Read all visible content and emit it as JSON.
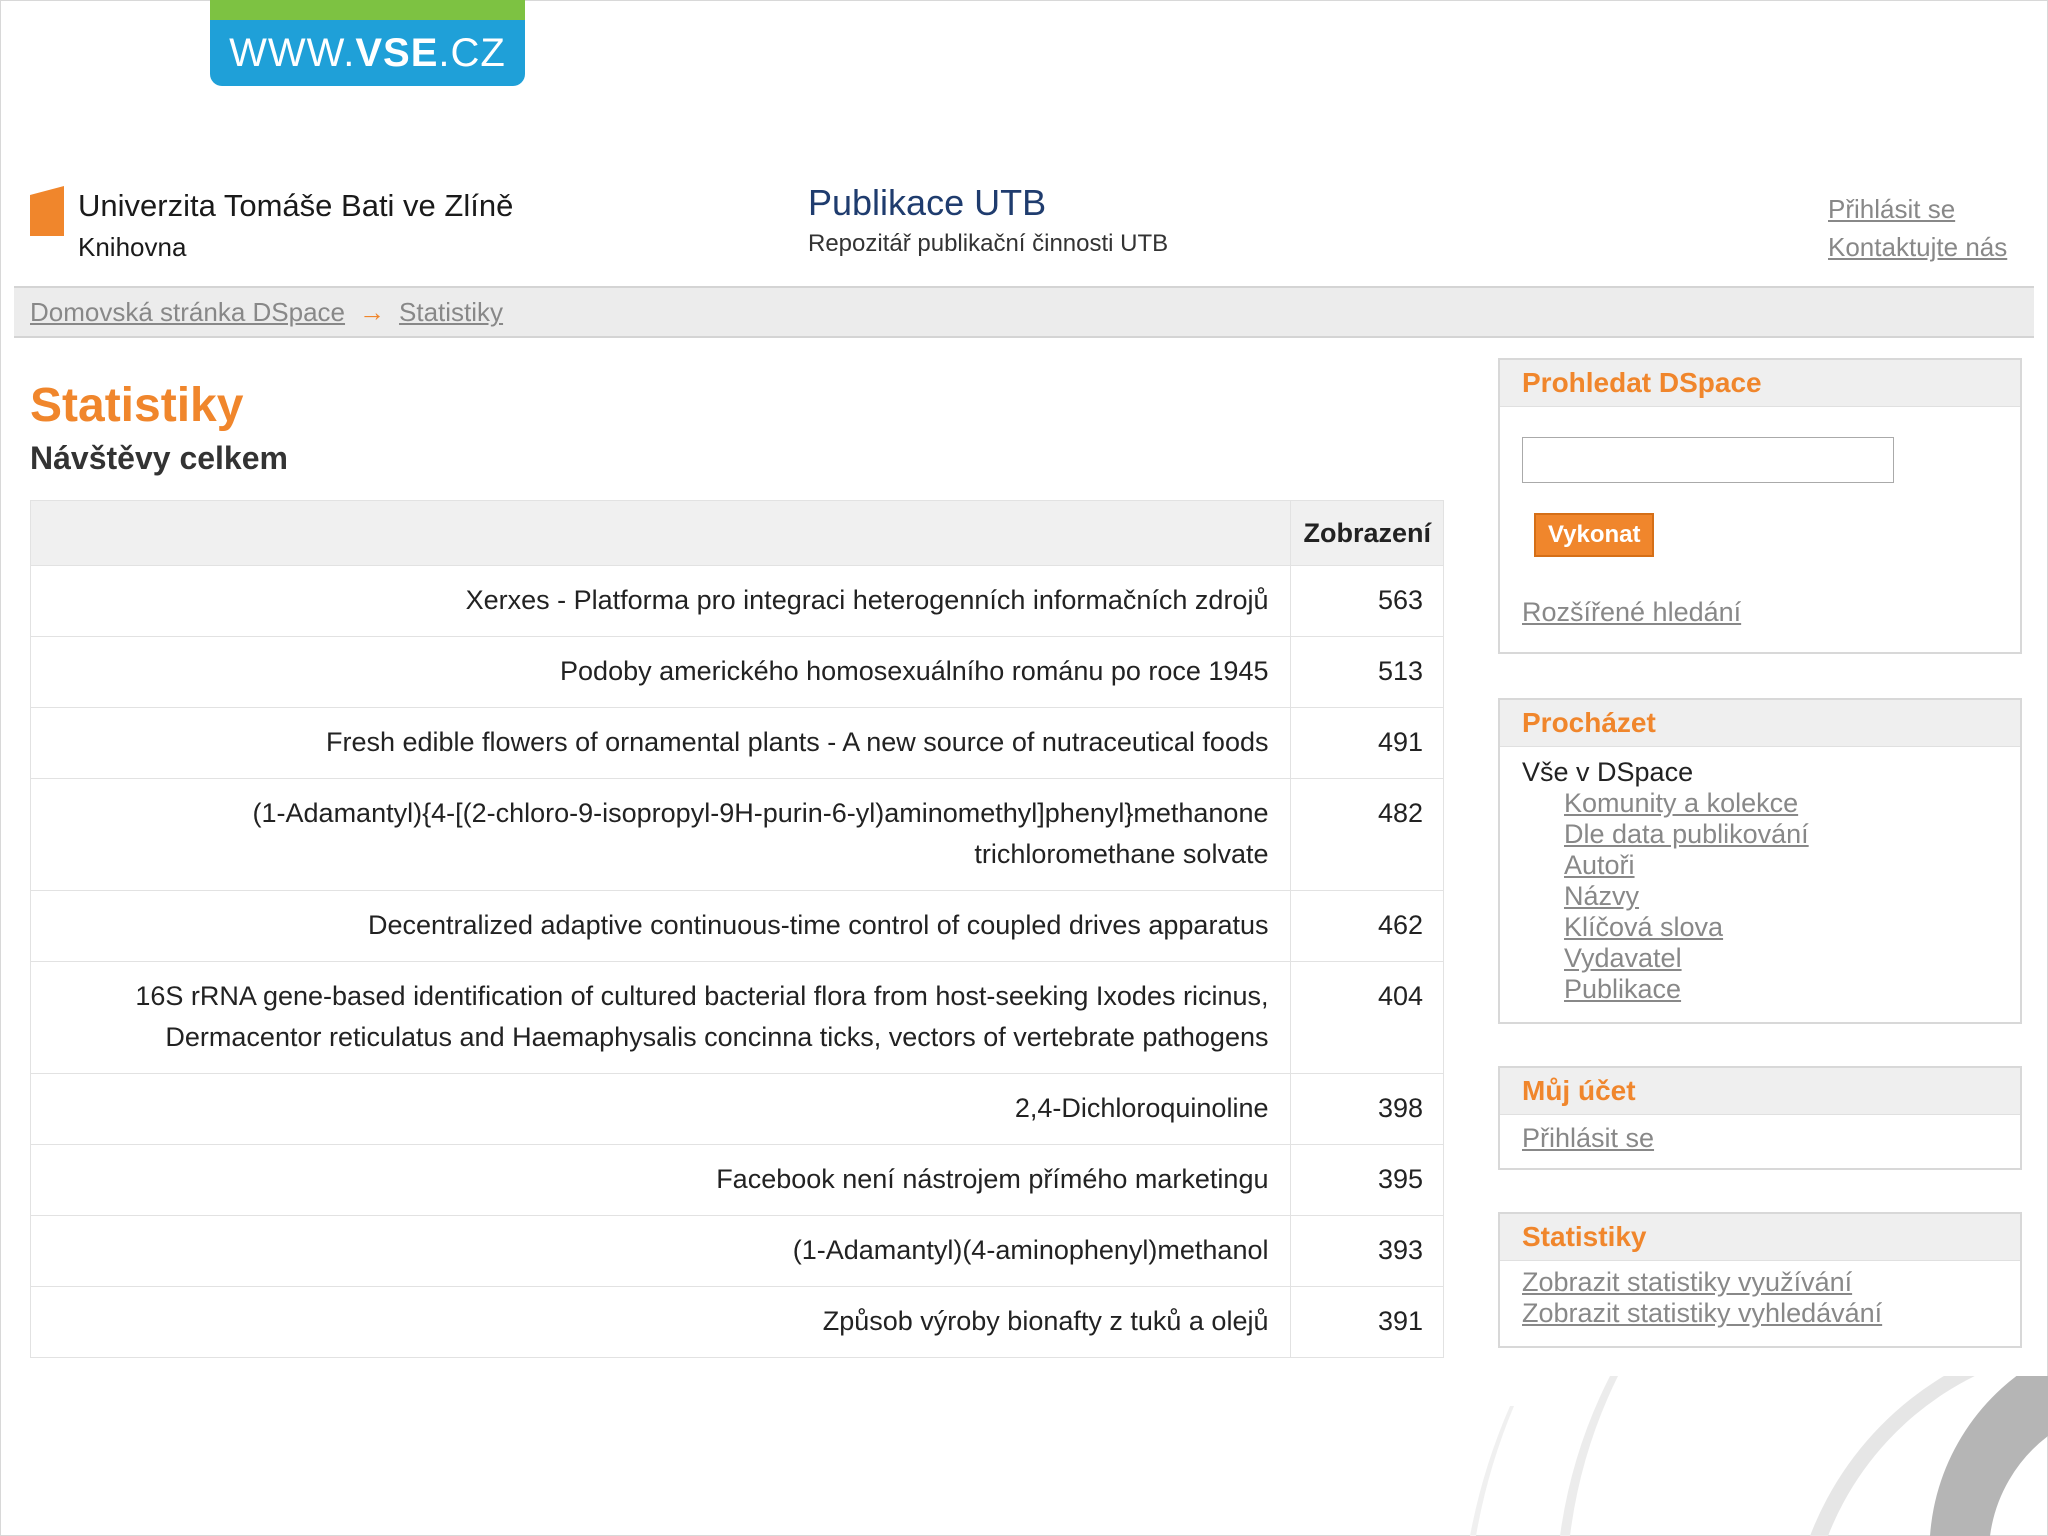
{
  "badge": {
    "prefix": "WWW.",
    "bold": "VSE",
    "suffix": ".CZ"
  },
  "header": {
    "university": "Univerzita Tomáše Bati ve Zlíně",
    "library": "Knihovna",
    "site_title": "Publikace UTB",
    "site_subtitle": "Repozitář publikační činnosti UTB",
    "login": "Přihlásit se",
    "contact": "Kontaktujte nás"
  },
  "breadcrumb": {
    "home": "Domovská stránka DSpace",
    "arrow": "→",
    "current": "Statistiky"
  },
  "main": {
    "title": "Statistiky",
    "section": "Návštěvy celkem",
    "column_header": "Zobrazení",
    "rows": [
      {
        "title": "Xerxes - Platforma pro integraci heterogenních informačních zdrojů",
        "views": "563"
      },
      {
        "title": "Podoby amerického homosexuálního románu po roce 1945",
        "views": "513"
      },
      {
        "title": "Fresh edible flowers of ornamental plants - A new source of nutraceutical foods",
        "views": "491"
      },
      {
        "title": "(1-Adamantyl){4-[(2-chloro-9-isopropyl-9H-purin-6-yl)aminomethyl]phenyl}methanone trichloromethane solvate",
        "views": "482"
      },
      {
        "title": "Decentralized adaptive continuous-time control of coupled drives apparatus",
        "views": "462"
      },
      {
        "title": "16S rRNA gene-based identification of cultured bacterial flora from host-seeking Ixodes ricinus, Dermacentor reticulatus and Haemaphysalis concinna ticks, vectors of vertebrate pathogens",
        "views": "404"
      },
      {
        "title": "2,4-Dichloroquinoline",
        "views": "398"
      },
      {
        "title": "Facebook není nástrojem přímého marketingu",
        "views": "395"
      },
      {
        "title": "(1-Adamantyl)(4-aminophenyl)methanol",
        "views": "393"
      },
      {
        "title": "Způsob výroby bionafty z tuků a olejů",
        "views": "391"
      }
    ]
  },
  "sidebar": {
    "search": {
      "heading": "Prohledat DSpace",
      "value": "",
      "button": "Vykonat",
      "advanced": "Rozšířené hledání"
    },
    "browse": {
      "heading": "Procházet",
      "top": "Vše v DSpace",
      "items": [
        "Komunity a kolekce",
        "Dle data publikování",
        "Autoři",
        "Názvy",
        "Klíčová slova",
        "Vydavatel",
        "Publikace"
      ]
    },
    "account": {
      "heading": "Můj účet",
      "login": "Přihlásit se"
    },
    "statistics": {
      "heading": "Statistiky",
      "usage": "Zobrazit statistiky využívání",
      "search": "Zobrazit statistiky vyhledávání"
    }
  },
  "colors": {
    "accent": "#f0862c",
    "badge_blue": "#1fa0d8",
    "badge_green": "#7dc242",
    "title_navy": "#1f3c6e"
  }
}
